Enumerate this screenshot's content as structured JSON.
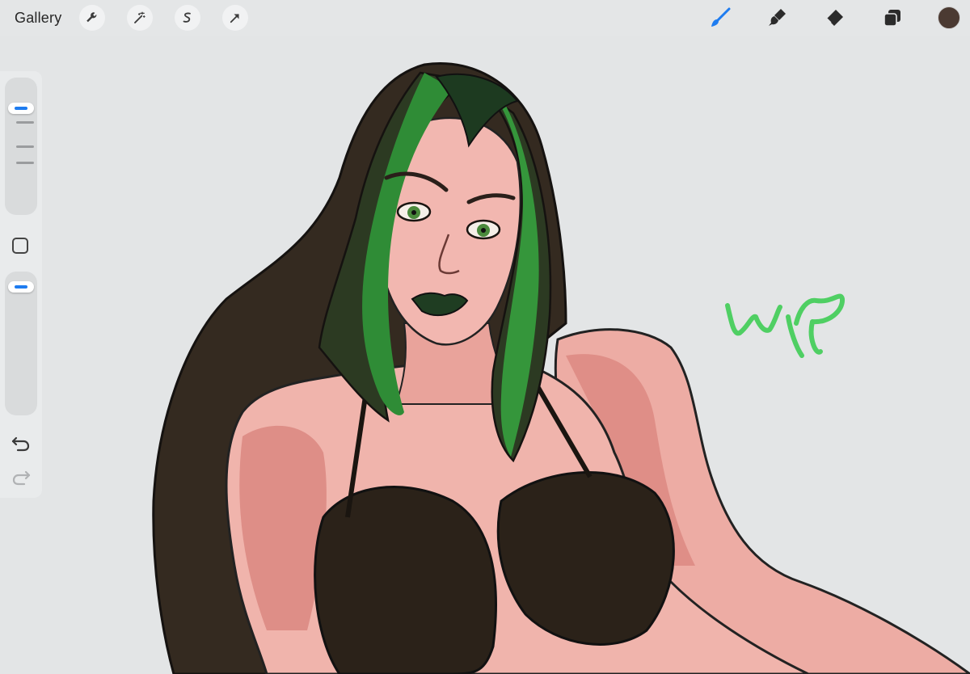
{
  "toolbar": {
    "gallery_label": "Gallery",
    "left_tools": [
      "wrench-icon",
      "magic-wand-icon",
      "selection-icon",
      "transform-arrow-icon"
    ],
    "right_tools": [
      "brush-icon",
      "smudge-icon",
      "eraser-icon",
      "layers-icon"
    ],
    "active_tool": "brush-icon",
    "accent_color": "#1e7cf0",
    "current_color": "#4b3a32"
  },
  "sidebar": {
    "controls": [
      "brush-size-slider",
      "modify-button",
      "opacity-slider",
      "undo-icon",
      "redo-icon"
    ]
  },
  "canvas": {
    "background": "#e3e5e6",
    "handwritten_text": "wip",
    "handwritten_color": "#4fcf63",
    "palette": {
      "hair": "#2f2a22",
      "hair_highlight": "#2f8a34",
      "skin": "#efb2aa",
      "skin_shade": "#c9615c",
      "top": "#2a231c",
      "lips": "#1f3d22",
      "eyes": "#4a8a3c"
    }
  }
}
